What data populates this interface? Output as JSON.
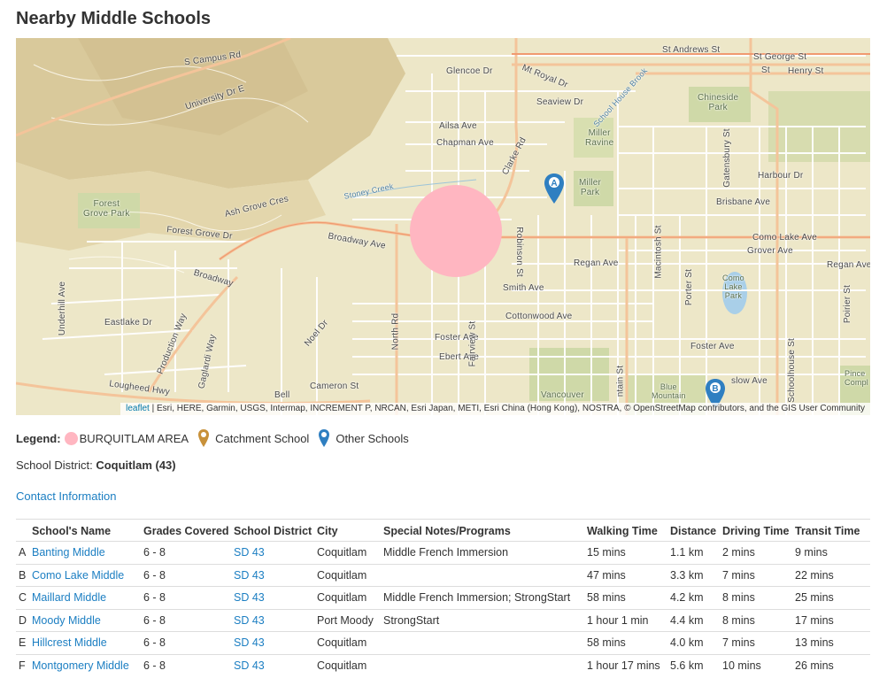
{
  "page": {
    "title": "Nearby Middle Schools"
  },
  "map": {
    "attribution_leaflet": "leaflet",
    "attribution_rest": " | Esri, HERE, Garmin, USGS, Intermap, INCREMENT P, NRCAN, Esri Japan, METI, Esri China (Hong Kong), NOSTRA, © OpenStreetMap contributors, and the GIS User Community",
    "markers": [
      {
        "letter": "A",
        "color": "#2f7fc1"
      },
      {
        "letter": "B",
        "color": "#2f7fc1"
      }
    ],
    "area_color": "#ffb6c1",
    "labels": {
      "s_campus_rd": "S Campus Rd",
      "university_dr_e": "University Dr E",
      "glencoe_dr": "Glencoe Dr",
      "mt_royal_dr": "Mt Royal Dr",
      "seaview_dr": "Seaview Dr",
      "ailsa_ave": "Ailsa Ave",
      "chapman_ave": "Chapman Ave",
      "clarke_rd": "Clarke Rd",
      "st_andrews_st": "St Andrews St",
      "st_george_st": "St George St",
      "st_henry_st": "St",
      "henry_st": "Henry St",
      "chineside_park": "Chineside\nPark",
      "miller_ravine": "Miller\nRavine",
      "miller_park": "Miller\nPark",
      "school_house_brook": "School House Brook",
      "harbour_dr": "Harbour Dr",
      "brisbane_ave": "Brisbane Ave",
      "gatensbury_st": "Gatensbury St",
      "como_lake_ave": "Como Lake Ave",
      "grover_ave": "Grover Ave",
      "regan_ave": "Regan Ave",
      "regan_ave_2": "Regan Ave",
      "forest_grove_park": "Forest\nGrove Park",
      "ash_grove_cres": "Ash Grove Cres",
      "forest_grove_dr": "Forest Grove Dr",
      "stoney_creek": "Stoney Creek",
      "broadway_ave": "Broadway Ave",
      "broadway": "Broadway",
      "robinson_st": "Robinson St",
      "macintosh_st": "Macintosh St",
      "porter_st": "Porter St",
      "como_lake_park": "Como\nLake\nPark",
      "smith_ave": "Smith Ave",
      "cottonwood_ave": "Cottonwood Ave",
      "underhill_ave": "Underhill Ave",
      "eastlake_dr": "Eastlake Dr",
      "production_way": "Production Way",
      "gaglardi_way": "Gaglardi Way",
      "noel_dr": "Noel Dr",
      "north_rd": "North Rd",
      "foster_ave": "Foster Ave",
      "foster_ave_2": "Foster Ave",
      "ebert_ave": "Ebert Ave",
      "fairview_st": "Fairview St",
      "poirier_st": "Poirier St",
      "schoolhouse_st": "Schoolhouse St",
      "lougheed_hwy": "Lougheed Hwy",
      "cameron_st": "Cameron St",
      "bell": "Bell",
      "vancouver": "Vancouver",
      "blue_mountain": "Blue\nMountain",
      "ntain_st": "ntain St",
      "aslow_ave": "slow Ave",
      "pince_compl": "Pince\nCompl"
    }
  },
  "legend": {
    "title": "Legend:",
    "area": "BURQUITLAM AREA",
    "catchment": "Catchment School",
    "other": "Other Schools",
    "catchment_color": "#c8913a",
    "other_color": "#2f7fc1"
  },
  "district": {
    "label": "School District:",
    "value": "Coquitlam (43)"
  },
  "contact": {
    "label": "Contact Information"
  },
  "table": {
    "headers": [
      "",
      "School's Name",
      "Grades Covered",
      "School District",
      "City",
      "Special Notes/Programs",
      "Walking Time",
      "Distance",
      "Driving Time",
      "Transit Time"
    ],
    "rows": [
      {
        "letter": "A",
        "name": "Banting Middle",
        "grades": "6 - 8",
        "district": "SD 43",
        "city": "Coquitlam",
        "notes": "Middle French Immersion",
        "walk": "15 mins",
        "distance": "1.1 km",
        "drive": "2 mins",
        "transit": "9 mins"
      },
      {
        "letter": "B",
        "name": "Como Lake Middle",
        "grades": "6 - 8",
        "district": "SD 43",
        "city": "Coquitlam",
        "notes": "",
        "walk": "47 mins",
        "distance": "3.3 km",
        "drive": "7 mins",
        "transit": "22 mins"
      },
      {
        "letter": "C",
        "name": "Maillard Middle",
        "grades": "6 - 8",
        "district": "SD 43",
        "city": "Coquitlam",
        "notes": "Middle French Immersion; StrongStart",
        "walk": "58 mins",
        "distance": "4.2 km",
        "drive": "8 mins",
        "transit": "25 mins"
      },
      {
        "letter": "D",
        "name": "Moody Middle",
        "grades": "6 - 8",
        "district": "SD 43",
        "city": "Port Moody",
        "notes": "StrongStart",
        "walk": "1 hour 1 min",
        "distance": "4.4 km",
        "drive": "8 mins",
        "transit": "17 mins"
      },
      {
        "letter": "E",
        "name": "Hillcrest Middle",
        "grades": "6 - 8",
        "district": "SD 43",
        "city": "Coquitlam",
        "notes": "",
        "walk": "58 mins",
        "distance": "4.0 km",
        "drive": "7 mins",
        "transit": "13 mins"
      },
      {
        "letter": "F",
        "name": "Montgomery Middle",
        "grades": "6 - 8",
        "district": "SD 43",
        "city": "Coquitlam",
        "notes": "",
        "walk": "1 hour 17 mins",
        "distance": "5.6 km",
        "drive": "10 mins",
        "transit": "26 mins"
      }
    ]
  }
}
